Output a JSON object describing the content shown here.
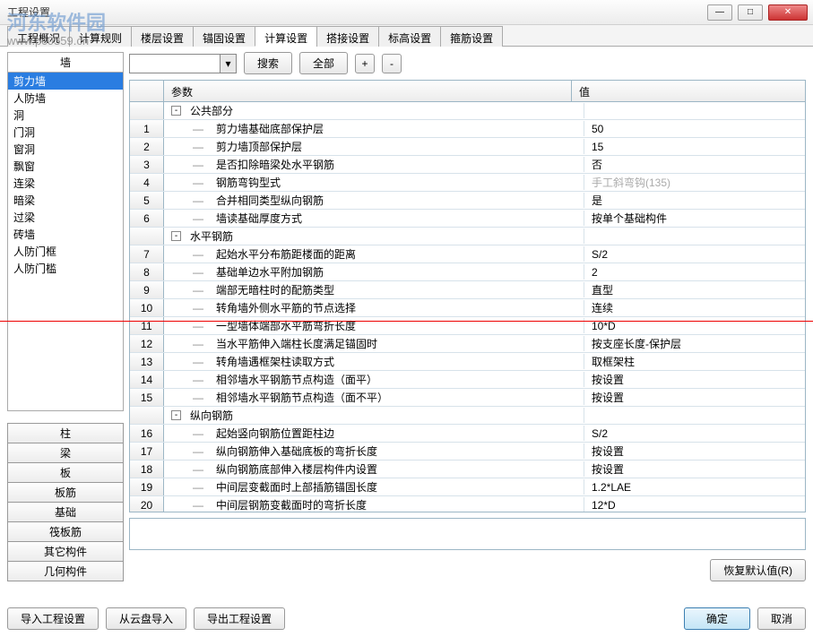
{
  "window": {
    "title": "工程设置"
  },
  "watermark": {
    "logo": "河东软件园",
    "url": "www.pc0359.cn"
  },
  "win_btns": {
    "min": "—",
    "max": "□",
    "close": "✕"
  },
  "tabs": [
    "工程概况",
    "计算规则",
    "楼层设置",
    "锚固设置",
    "计算设置",
    "搭接设置",
    "标高设置",
    "箍筋设置"
  ],
  "active_tab": 4,
  "left": {
    "header": "墙",
    "items": [
      "剪力墙",
      "人防墙",
      "洞",
      "门洞",
      "窗洞",
      "飘窗",
      "连梁",
      "暗梁",
      "过梁",
      "砖墙",
      "人防门框",
      "人防门槛"
    ],
    "components": [
      "柱",
      "梁",
      "板",
      "板筋",
      "基础",
      "筏板筋",
      "其它构件",
      "几何构件"
    ]
  },
  "toolbar": {
    "search": "搜索",
    "all": "全部",
    "plus": "+",
    "minus": "-"
  },
  "grid": {
    "header_param": "参数",
    "header_val": "值",
    "rows": [
      {
        "type": "group",
        "label": "公共部分"
      },
      {
        "num": "1",
        "param": "剪力墙基础底部保护层",
        "val": "50"
      },
      {
        "num": "2",
        "param": "剪力墙顶部保护层",
        "val": "15"
      },
      {
        "num": "3",
        "param": "是否扣除暗梁处水平钢筋",
        "val": "否"
      },
      {
        "num": "4",
        "param": "钢筋弯钩型式",
        "val": "手工斜弯钩(135)",
        "disabled": true
      },
      {
        "num": "5",
        "param": "合并相同类型纵向钢筋",
        "val": "是"
      },
      {
        "num": "6",
        "param": "墙读基础厚度方式",
        "val": "按单个基础构件"
      },
      {
        "type": "group",
        "label": "水平钢筋"
      },
      {
        "num": "7",
        "param": "起始水平分布筋距楼面的距离",
        "val": "S/2"
      },
      {
        "num": "8",
        "param": "基础单边水平附加钢筋",
        "val": "2"
      },
      {
        "num": "9",
        "param": "端部无暗柱时的配筋类型",
        "val": "直型"
      },
      {
        "num": "10",
        "param": "转角墙外侧水平筋的节点选择",
        "val": "连续"
      },
      {
        "num": "11",
        "param": "一型墙体端部水平筋弯折长度",
        "val": "10*D"
      },
      {
        "num": "12",
        "param": "当水平筋伸入端柱长度满足锚固时",
        "val": "按支座长度-保护层"
      },
      {
        "num": "13",
        "param": "转角墙遇框架柱读取方式",
        "val": "取框架柱"
      },
      {
        "num": "14",
        "param": "相邻墙水平钢筋节点构造（面平）",
        "val": "按设置"
      },
      {
        "num": "15",
        "param": "相邻墙水平钢筋节点构造（面不平）",
        "val": "按设置"
      },
      {
        "type": "group",
        "label": "纵向钢筋"
      },
      {
        "num": "16",
        "param": "起始竖向钢筋位置距柱边",
        "val": "S/2"
      },
      {
        "num": "17",
        "param": "纵向钢筋伸入基础底板的弯折长度",
        "val": "按设置"
      },
      {
        "num": "18",
        "param": "纵向钢筋底部伸入楼层构件内设置",
        "val": "按设置"
      },
      {
        "num": "19",
        "param": "中间层变截面时上部插筋锚固长度",
        "val": "1.2*LAE"
      },
      {
        "num": "20",
        "param": "中间层钢筋变截面时的弯折长度",
        "val": "12*D"
      }
    ]
  },
  "buttons": {
    "restore": "恢复默认值(R)",
    "import_proj": "导入工程设置",
    "import_cloud": "从云盘导入",
    "export_proj": "导出工程设置",
    "ok": "确定",
    "cancel": "取消"
  }
}
